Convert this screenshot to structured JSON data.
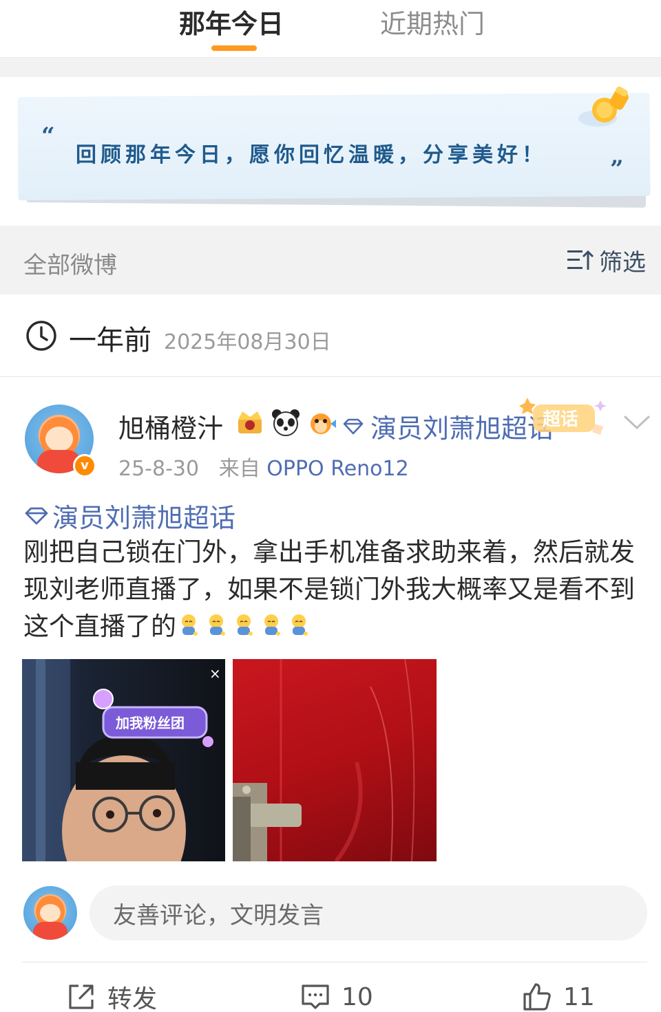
{
  "tabs": [
    {
      "label": "那年今日",
      "active": true
    },
    {
      "label": "近期热门",
      "active": false
    }
  ],
  "banner": {
    "text": "回顾那年今日，愿你回忆温暖，分享美好！",
    "quote_open": "“",
    "quote_close": "”"
  },
  "filter": {
    "title": "全部微博",
    "button_label": "筛选",
    "icon": "sort-filter-icon"
  },
  "date_header": {
    "relative": "一年前",
    "date": "2025年08月30日",
    "icon": "clock-icon"
  },
  "post": {
    "username": "旭桶橙汁",
    "topic_tag": "演员刘萧旭超话",
    "super_tag": "超话",
    "time": "25-8-30",
    "source_prefix": "来自",
    "device": "OPPO Reno12",
    "topic_link": "演员刘萧旭超话",
    "text": "刚把自己锁在门外，拿出手机准备求助来着，然后就发现刘老师直播了，如果不是锁门外我大概率又是看不到这个直播了的",
    "emoji_count": 5,
    "images": [
      {
        "overlay_label": "加我粉丝团",
        "close_glyph": "×"
      },
      {}
    ]
  },
  "comment": {
    "placeholder": "友善评论，文明发言"
  },
  "actions": {
    "repost_label": "转发",
    "comment_count": "10",
    "like_count": "11"
  },
  "colors": {
    "accent": "#ff9a1f",
    "link": "#4f6db3",
    "banner_text": "#1f5a8c"
  }
}
